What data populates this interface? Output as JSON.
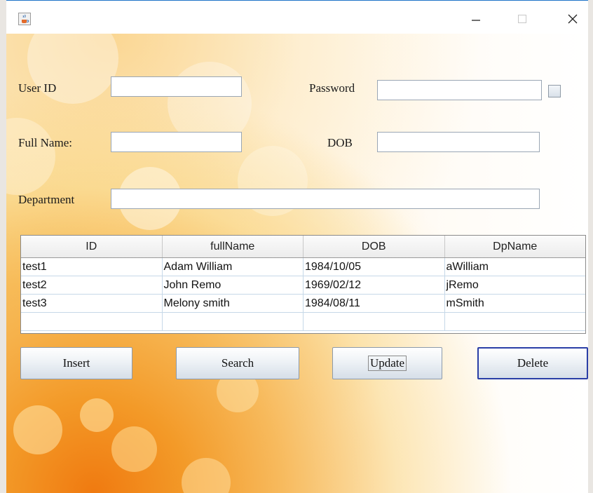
{
  "window": {
    "title": "",
    "icons": {
      "app": "java-cup-icon",
      "minimize": "minimize-icon",
      "maximize": "maximize-icon",
      "close": "close-icon"
    }
  },
  "form": {
    "user_id": {
      "label": "User ID",
      "value": ""
    },
    "password": {
      "label": "Password",
      "value": "",
      "show_password_checked": false
    },
    "full_name": {
      "label": "Full Name:",
      "value": ""
    },
    "dob": {
      "label": "DOB",
      "value": ""
    },
    "department": {
      "label": "Department",
      "value": ""
    }
  },
  "table": {
    "columns": [
      "ID",
      "fullName",
      "DOB",
      "DpName"
    ],
    "rows": [
      [
        "test1",
        "Adam William",
        "1984/10/05",
        "aWilliam"
      ],
      [
        "test2",
        "John Remo",
        "1969/02/12",
        "jRemo"
      ],
      [
        "test3",
        "Melony smith",
        "1984/08/11",
        "mSmith"
      ],
      [
        "",
        "",
        "",
        ""
      ]
    ]
  },
  "buttons": {
    "insert": "Insert",
    "search": "Search",
    "update": "Update",
    "delete": "Delete"
  },
  "colors": {
    "accent_orange": "#f07a10",
    "focus_border": "#2a3ea6",
    "titlebar_top": "#1e73c8"
  }
}
